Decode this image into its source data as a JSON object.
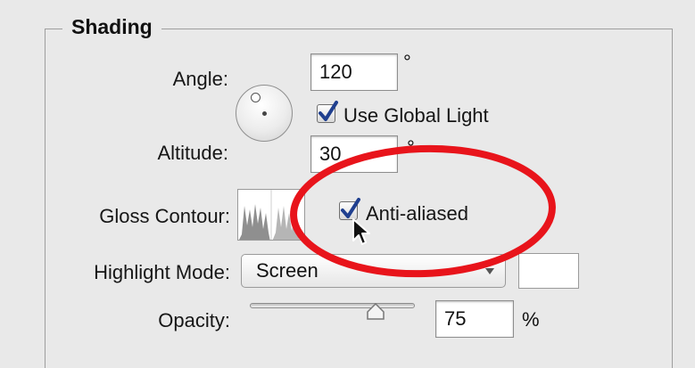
{
  "section": {
    "title": "Shading"
  },
  "angle": {
    "label": "Angle:",
    "value": "120",
    "unit": "°"
  },
  "use_global_light": {
    "label": "Use Global Light",
    "checked": true
  },
  "altitude": {
    "label": "Altitude:",
    "value": "30",
    "unit": "°"
  },
  "gloss_contour": {
    "label": "Gloss Contour:",
    "anti_aliased_label": "Anti-aliased",
    "anti_aliased_checked": true
  },
  "highlight_mode": {
    "label": "Highlight Mode:",
    "value": "Screen",
    "color": "#ffffff"
  },
  "opacity": {
    "label": "Opacity:",
    "value": "75",
    "unit": "%",
    "slider_fraction": 0.75
  },
  "colors": {
    "annotation_ring": "#e8141b",
    "check": "#1f3f8f"
  }
}
